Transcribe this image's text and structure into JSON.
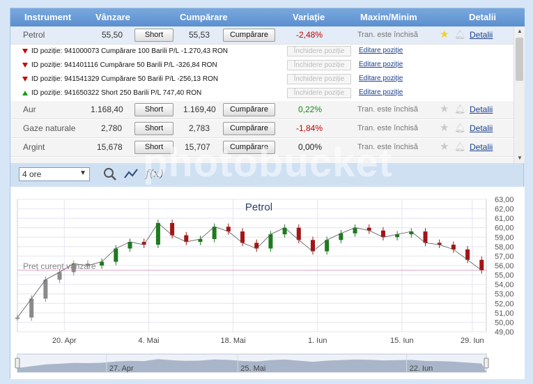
{
  "header": {
    "instrument": "Instrument",
    "sell": "Vânzare",
    "buy": "Cumpărare",
    "change": "Variație",
    "maxmin": "Maxim/Minim",
    "details": "Detalii"
  },
  "instruments": [
    {
      "name": "Petrol",
      "sell": "55,50",
      "buy": "55,53",
      "change": "-2,48%",
      "change_dir": "neg",
      "status": "Tran. este închisă",
      "star": true,
      "short_label": "Short",
      "buy_label": "Cumpărare",
      "details_label": "Detalii"
    },
    {
      "name": "Aur",
      "sell": "1.168,40",
      "buy": "1.169,40",
      "change": "0,22%",
      "change_dir": "pos",
      "status": "Tran. este închisă",
      "star": false,
      "short_label": "Short",
      "buy_label": "Cumpărare",
      "details_label": "Detalii"
    },
    {
      "name": "Gaze naturale",
      "sell": "2,780",
      "buy": "2,783",
      "change": "-1,84%",
      "change_dir": "neg",
      "status": "Tran. este închisă",
      "star": false,
      "short_label": "Short",
      "buy_label": "Cumpărare",
      "details_label": "Detalii"
    },
    {
      "name": "Argint",
      "sell": "15,678",
      "buy": "15,707",
      "change": "0,00%",
      "change_dir": "zero",
      "status": "Tran. este închisă",
      "star": false,
      "short_label": "Short",
      "buy_label": "Cumpărare",
      "details_label": "Detalii"
    }
  ],
  "positions": [
    {
      "dir": "down",
      "text": "ID poziție: 941000073 Cumpărare 100 Barili P/L -1.270,43 RON",
      "close_label": "Închidere poziție",
      "edit_label": "Editare poziție"
    },
    {
      "dir": "down",
      "text": "ID poziție: 941401116 Cumpărare 50 Barili P/L -326,84 RON",
      "close_label": "Închidere poziție",
      "edit_label": "Editare poziție"
    },
    {
      "dir": "down",
      "text": "ID poziție: 941541329 Cumpărare 50 Barili P/L -256,13 RON",
      "close_label": "Închidere poziție",
      "edit_label": "Editare poziție"
    },
    {
      "dir": "up",
      "text": "ID poziție: 941650322 Short 250 Barili P/L 747,40 RON",
      "close_label": "Închidere poziție",
      "edit_label": "Editare poziție"
    }
  ],
  "toolbar": {
    "period": "4 ore",
    "icons": [
      "zoom-icon",
      "line-chart-icon",
      "function-icon"
    ],
    "function_label": "f(x)"
  },
  "colors": {
    "header": "#5b8fcf",
    "negative": "#c00000",
    "positive": "#138a13",
    "up_candle": "#1e7a1e",
    "down_candle": "#a31515",
    "sell_line": "#e7a3c0"
  },
  "watermark": "photobucket",
  "chart_data": {
    "type": "candlestick",
    "title": "Petrol",
    "annotation": "Preț curent vânzare",
    "current_price": 55.5,
    "ylim": [
      49,
      63
    ],
    "y_ticks": [
      "63,00",
      "62,00",
      "61,00",
      "60,00",
      "59,00",
      "58,00",
      "57,00",
      "56,00",
      "55,00",
      "54,00",
      "53,00",
      "52,00",
      "51,00",
      "50,00",
      "49,00"
    ],
    "x_tick_labels": [
      "20. Apr",
      "4. Mai",
      "18. Mai",
      "1. Iun",
      "15. Iun",
      "29. Iun"
    ],
    "x_tick_positions": [
      0.1,
      0.28,
      0.46,
      0.64,
      0.82,
      0.97
    ],
    "x": [
      0,
      0.03,
      0.06,
      0.09,
      0.12,
      0.15,
      0.18,
      0.21,
      0.24,
      0.27,
      0.3,
      0.33,
      0.36,
      0.39,
      0.42,
      0.45,
      0.48,
      0.51,
      0.54,
      0.57,
      0.6,
      0.63,
      0.66,
      0.69,
      0.72,
      0.75,
      0.78,
      0.81,
      0.84,
      0.87,
      0.9,
      0.93,
      0.96,
      0.99
    ],
    "y": [
      50.5,
      52.5,
      54.5,
      55.3,
      56.2,
      56.0,
      56.4,
      57.8,
      58.5,
      58.2,
      60.5,
      59.2,
      58.5,
      58.8,
      60.1,
      59.6,
      58.4,
      57.8,
      59.3,
      60.0,
      58.7,
      57.5,
      58.7,
      59.4,
      60.0,
      59.7,
      59.0,
      59.3,
      59.6,
      58.4,
      58.2,
      57.7,
      56.6,
      55.5
    ],
    "navigator": {
      "labels": [
        "27. Apr",
        "25. Mai",
        "22. Iun"
      ],
      "positions": [
        0.19,
        0.47,
        0.83
      ]
    }
  }
}
